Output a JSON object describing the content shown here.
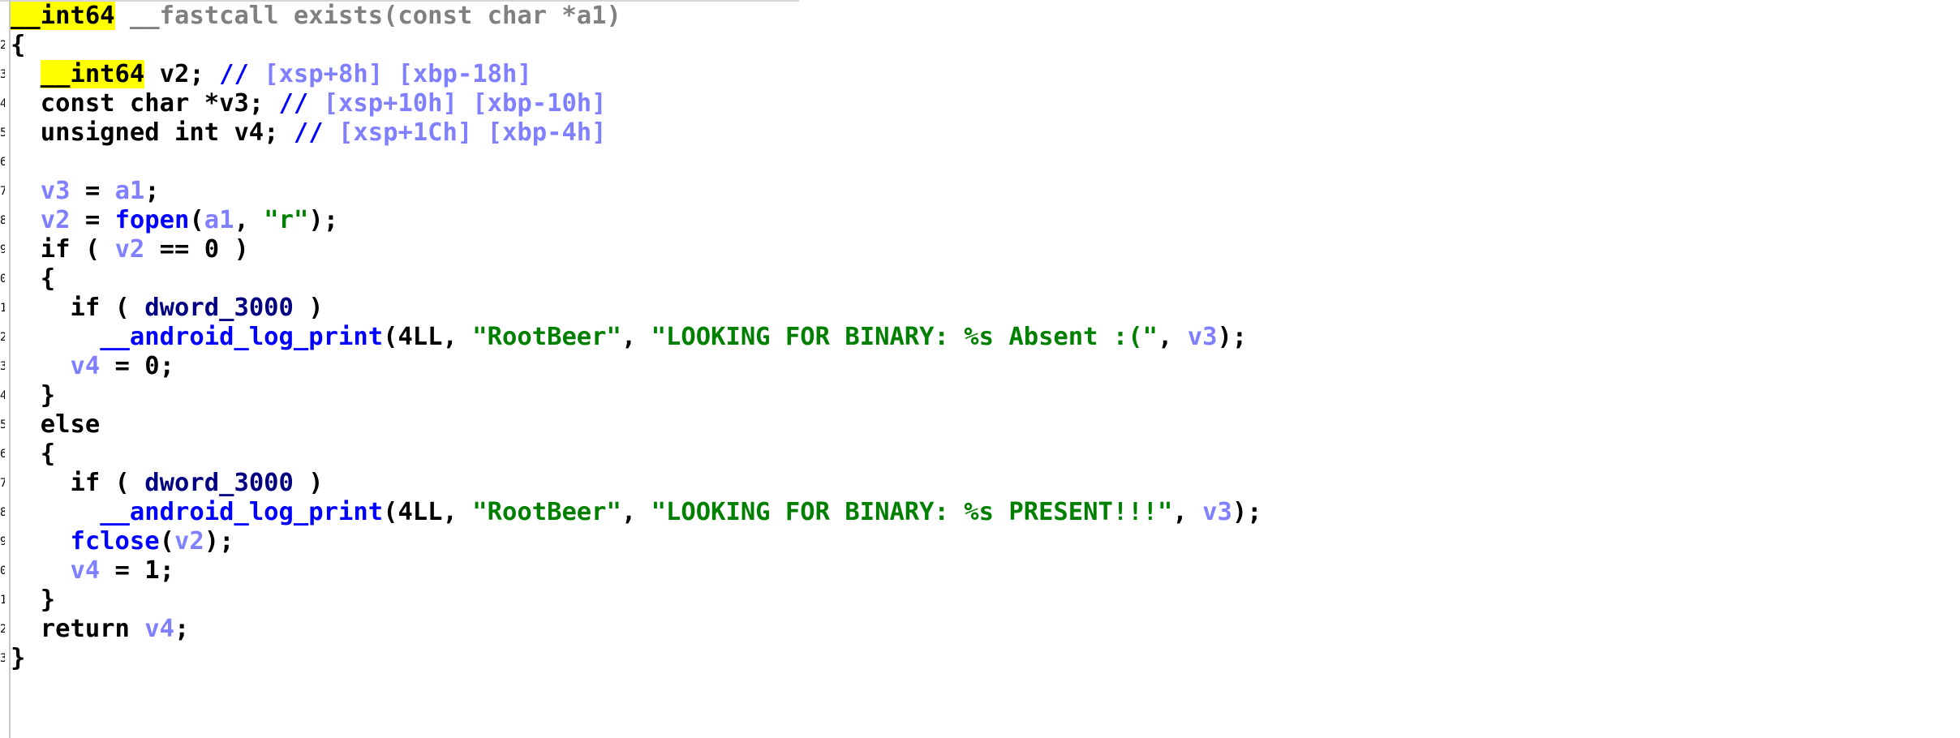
{
  "code": {
    "sig_type": "__int64",
    "sig_rest": " __fastcall exists(const char *a1)",
    "open_brace": "{",
    "l3_type": "__int64",
    "l3_var": " v2; ",
    "l3_comment": "// ",
    "l3_offsets": "[xsp+8h] [xbp-18h]",
    "l4_decl": "const char *v3; ",
    "l4_comment": "// ",
    "l4_offsets": "[xsp+10h] [xbp-10h]",
    "l5_decl": "unsigned int v4; ",
    "l5_comment": "// ",
    "l5_offsets": "[xsp+1Ch] [xbp-4h]",
    "l7_v3": "v3",
    "l7_eq": " = ",
    "l7_a1": "a1",
    "l7_end": ";",
    "l8_v2": "v2",
    "l8_eq": " = ",
    "l8_fopen": "fopen",
    "l8_paren": "(",
    "l8_a1": "a1",
    "l8_comma": ", ",
    "l8_str": "\"r\"",
    "l8_end": ");",
    "l9_if": "if ( ",
    "l9_v2": "v2",
    "l9_rest": " == 0 )",
    "l10_brace": "{",
    "l11_if": "if ( ",
    "l11_dword": "dword_3000",
    "l11_close": " )",
    "l12_func": "__android_log_print",
    "l12_args1": "(4LL, ",
    "l12_tag": "\"RootBeer\"",
    "l12_comma": ", ",
    "l12_msg": "\"LOOKING FOR BINARY: %s Absent :(\"",
    "l12_comma2": ", ",
    "l12_v3": "v3",
    "l12_end": ");",
    "l13_v4": "v4",
    "l13_rest": " = 0;",
    "l14_brace": "}",
    "l15_else": "else",
    "l16_brace": "{",
    "l17_if": "if ( ",
    "l17_dword": "dword_3000",
    "l17_close": " )",
    "l18_func": "__android_log_print",
    "l18_args1": "(4LL, ",
    "l18_tag": "\"RootBeer\"",
    "l18_comma": ", ",
    "l18_msg": "\"LOOKING FOR BINARY: %s PRESENT!!!\"",
    "l18_comma2": ", ",
    "l18_v3": "v3",
    "l18_end": ");",
    "l19_fclose": "fclose",
    "l19_paren": "(",
    "l19_v2": "v2",
    "l19_end": ");",
    "l20_v4": "v4",
    "l20_rest": " = 1;",
    "l21_brace": "}",
    "l22_return": "return ",
    "l22_v4": "v4",
    "l22_end": ";",
    "close_brace": "}"
  },
  "gutter_marks": [
    "2",
    "3",
    "4",
    "5",
    "6",
    "7",
    "8",
    "9",
    "0",
    "1",
    "2",
    "3",
    "4",
    "5",
    "6",
    "7",
    "8",
    "9",
    "0",
    "1",
    "2",
    "3"
  ],
  "colors": {
    "keyword": "#000000",
    "variable": "#8080ff",
    "function": "#0000ff",
    "string": "#008000",
    "global": "#000080",
    "comment_offsets": "#8080ff",
    "highlight": "#ffff00"
  }
}
